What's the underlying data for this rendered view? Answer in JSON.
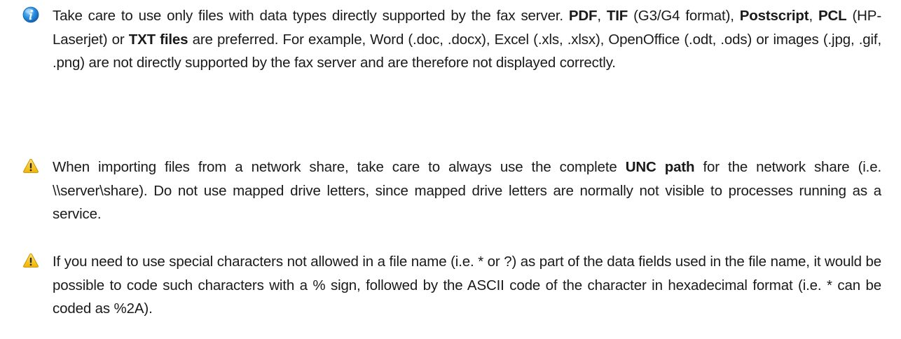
{
  "notes": [
    {
      "icon": "info-icon",
      "icon_color": "#1f7fd4",
      "parts": [
        {
          "t": "Take care to use only files with data types directly supported by the fax server. "
        },
        {
          "t": "PDF",
          "b": true
        },
        {
          "t": ", "
        },
        {
          "t": "TIF",
          "b": true
        },
        {
          "t": " (G3/G4 format), "
        },
        {
          "t": "Postscript",
          "b": true
        },
        {
          "t": ", "
        },
        {
          "t": "PCL",
          "b": true
        },
        {
          "t": " (HP-Laserjet) or "
        },
        {
          "t": "TXT files",
          "b": true
        },
        {
          "t": " are preferred. For example, Word (.doc, .docx), Excel (.xls, .xlsx), OpenOffice (.odt, .ods) or images (.jpg, .gif, .png) are not directly sup­ported by the fax server and are therefore not displayed correctly."
        }
      ]
    },
    {
      "icon": "warning-icon",
      "icon_color": "#f2c21b",
      "parts": [
        {
          "t": "When importing files from a network share, take care to always use the complete "
        },
        {
          "t": "UNC path",
          "b": true
        },
        {
          "t": " for the network share (i.e. \\\\server\\share). Do not use mapped drive letters, since mapped drive letters are normally not visible to processes running as a service."
        }
      ]
    },
    {
      "icon": "warning-icon",
      "icon_color": "#f2c21b",
      "parts": [
        {
          "t": "If you need to use special characters not allowed in a file name (i.e. * or ?) as part of the data fields used in the file name, it would be possible to code such characters with a % sign, fol­lowed by the ASCII code of the character in hexadecimal format (i.e. * can be coded as %2A)."
        }
      ]
    }
  ]
}
